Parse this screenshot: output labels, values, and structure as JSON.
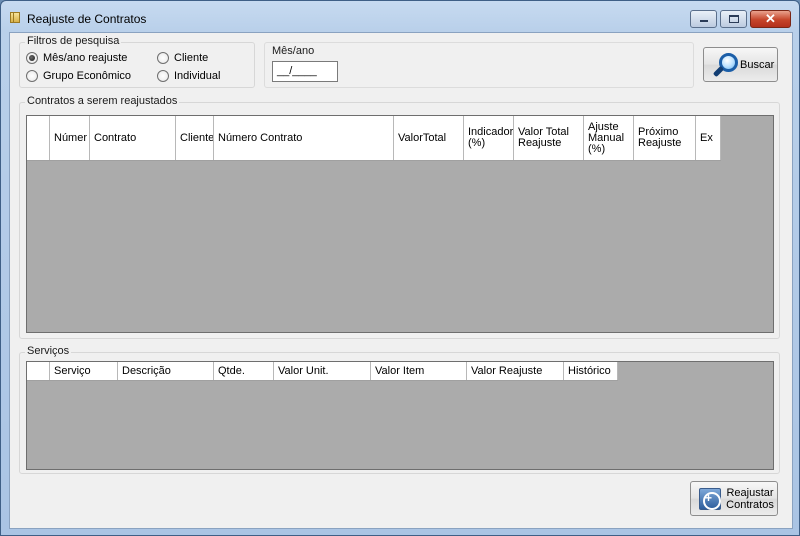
{
  "window": {
    "title": "Reajuste de Contratos"
  },
  "filters": {
    "legend": "Filtros de pesquisa",
    "options": [
      {
        "label": "Mês/ano reajuste",
        "checked": true
      },
      {
        "label": "Cliente",
        "checked": false
      },
      {
        "label": "Grupo Econômico",
        "checked": false
      },
      {
        "label": "Individual",
        "checked": false
      }
    ]
  },
  "month_year": {
    "legend": "Mês/ano",
    "value": "__/____"
  },
  "search_button": {
    "label": "Buscar",
    "icon": "magnifier-icon"
  },
  "contracts": {
    "legend": "Contratos a serem reajustados",
    "columns": [
      "Númer",
      "Contrato",
      "Cliente",
      "Número Contrato",
      "ValorTotal",
      "Indicador\n(%)",
      "Valor Total\nReajuste",
      "Ajuste\nManual\n(%)",
      "Próximo\nReajuste",
      "Ex"
    ]
  },
  "services": {
    "legend": "Serviços",
    "columns": [
      "Serviço",
      "Descrição",
      "Qtde.",
      "Valor Unit.",
      "Valor Item",
      "Valor Reajuste",
      "Histórico"
    ]
  },
  "readjust_button": {
    "label_line1": "Reajustar",
    "label_line2": "Contratos",
    "icon": "table-refresh-icon"
  }
}
